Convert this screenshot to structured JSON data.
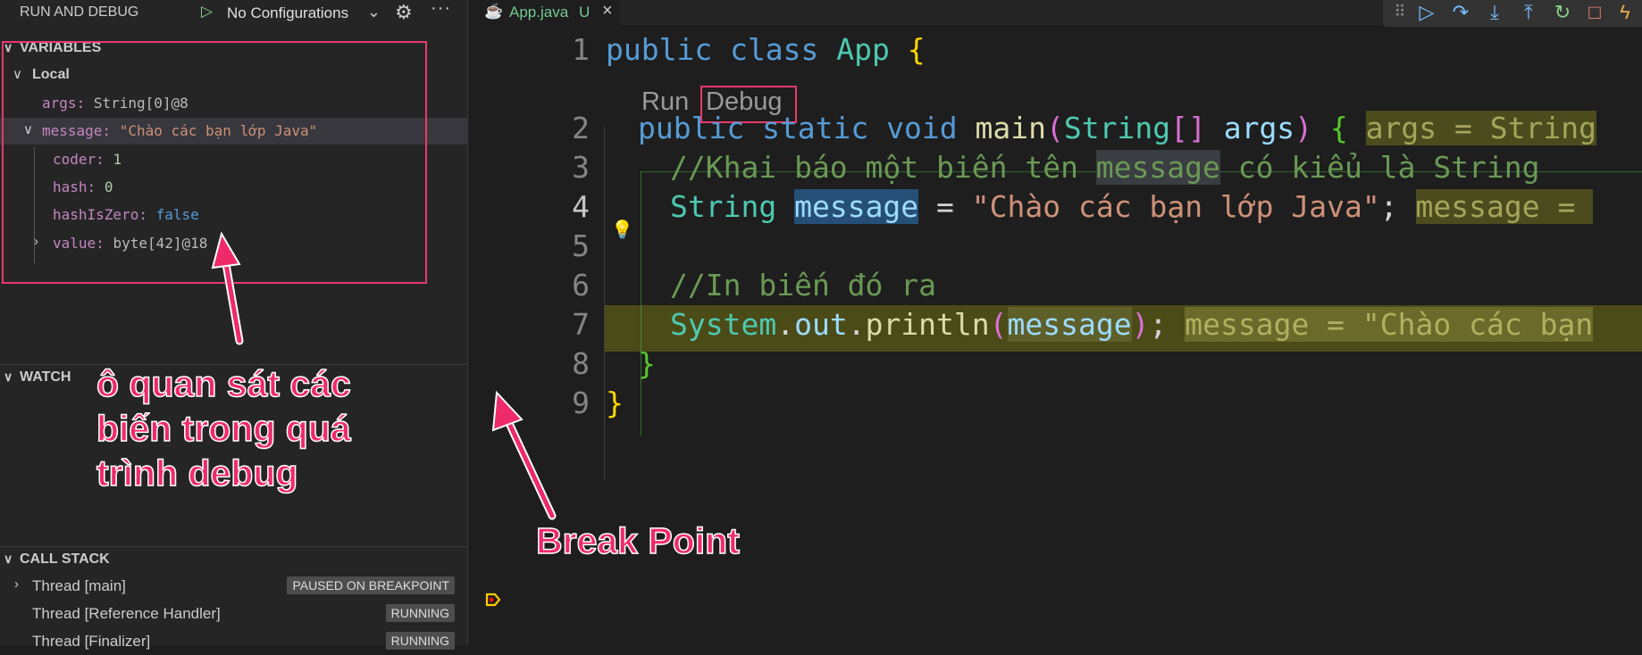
{
  "sidebar": {
    "title": "RUN AND DEBUG",
    "config_label": "No Configurations",
    "variables": {
      "header": "VARIABLES",
      "local_label": "Local",
      "args_name": "args:",
      "args_value": "String[0]@8",
      "message_name": "message:",
      "message_value": "\"Chào các bạn lớp Java\"",
      "coder_name": "coder:",
      "coder_value": "1",
      "hash_name": "hash:",
      "hash_value": "0",
      "hashIsZero_name": "hashIsZero:",
      "hashIsZero_value": "false",
      "value_name": "value:",
      "value_value": "byte[42]@18"
    },
    "watch_header": "WATCH",
    "call_stack": {
      "header": "CALL STACK",
      "threads": [
        {
          "name": "Thread [main]",
          "status": "PAUSED ON BREAKPOINT"
        },
        {
          "name": "Thread [Reference Handler]",
          "status": "RUNNING"
        },
        {
          "name": "Thread [Finalizer]",
          "status": "RUNNING"
        }
      ]
    }
  },
  "annotations": {
    "vars_note": "ô quan sát các biến trong quá trình debug",
    "breakpoint_note": "Break Point",
    "color": "#ee2a6b"
  },
  "tab": {
    "filename": "App.java",
    "status": "U"
  },
  "codelens": {
    "run": "Run",
    "debug": "Debug"
  },
  "code": {
    "line_numbers": [
      "1",
      "2",
      "3",
      "4",
      "5",
      "6",
      "7",
      "8",
      "9"
    ],
    "l1_kw": "public class",
    "l1_cls": "App",
    "l1_brace": "{",
    "l2_kw": "public static void",
    "l2_fn": "main",
    "l2_cls": "String",
    "l2_arr": "[]",
    "l2_var": "args",
    "l2_brace": "{",
    "l2_inline": "args = String",
    "l3_pre": "//Khai báo một biến tên ",
    "l3_word": "message",
    "l3_post": " có kiểu là String",
    "l4_cls": "String",
    "l4_var": "message",
    "l4_eq": " = ",
    "l4_str": "\"Chào các bạn lớp Java\"",
    "l4_semi": ";",
    "l4_inline": "message = ",
    "l6_cmt": "//In biến đó ra",
    "l7_cls": "System",
    "l7_dot1": ".",
    "l7_var1": "out",
    "l7_dot2": ".",
    "l7_fn": "println",
    "l7_var2": "message",
    "l7_semi": ";",
    "l7_inline": "message = \"Chào các bạn",
    "l8_brace": "}",
    "l9_brace": "}"
  },
  "colors": {
    "accent_box": "#e8396b",
    "paused_line": "#4b4b18",
    "breakpoint": "#ffcc00"
  }
}
